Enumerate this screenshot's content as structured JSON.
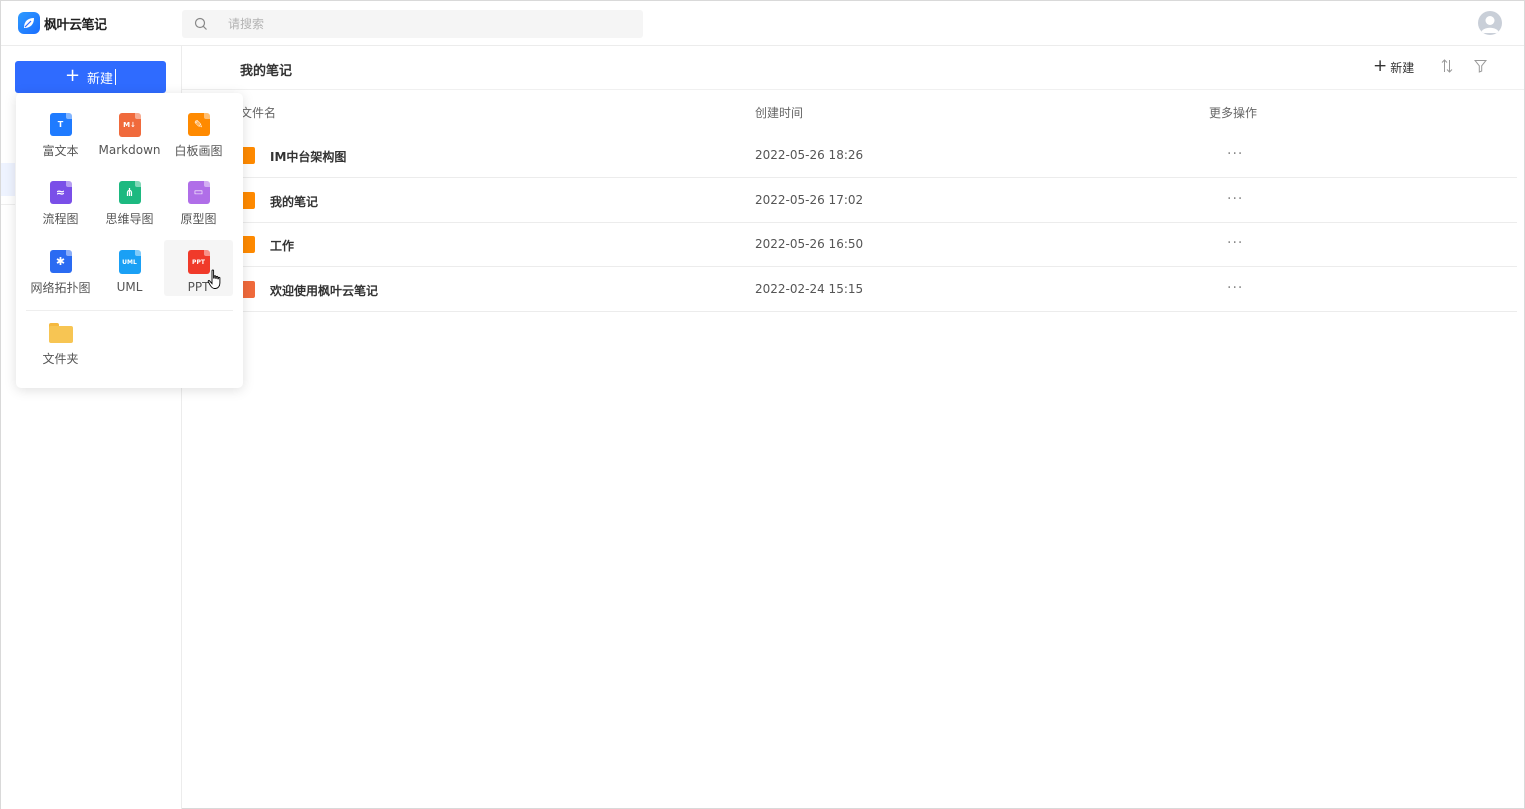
{
  "app": {
    "name": "枫叶云笔记",
    "brand_color": "#2f6bff"
  },
  "search": {
    "placeholder": "请搜索"
  },
  "sidebar": {
    "new_button_label": "新建"
  },
  "new_menu": {
    "items": [
      {
        "label": "富文本",
        "icon": "rich-text-icon",
        "color": "#1f7bff",
        "glyph": "T"
      },
      {
        "label": "Markdown",
        "icon": "markdown-icon",
        "color": "#f06a3c",
        "glyph": "M↓"
      },
      {
        "label": "白板画图",
        "icon": "whiteboard-icon",
        "color": "#ff8a00",
        "glyph": "✎"
      },
      {
        "label": "流程图",
        "icon": "flowchart-icon",
        "color": "#7a4fe8",
        "glyph": "≈"
      },
      {
        "label": "思维导图",
        "icon": "mindmap-icon",
        "color": "#1db980",
        "glyph": "⋔"
      },
      {
        "label": "原型图",
        "icon": "prototype-icon",
        "color": "#b06ee8",
        "glyph": "▭"
      },
      {
        "label": "网络拓扑图",
        "icon": "network-topology-icon",
        "color": "#2a6bf2",
        "glyph": "✱"
      },
      {
        "label": "UML",
        "icon": "uml-icon",
        "color": "#1aa0f5",
        "glyph": "UML"
      },
      {
        "label": "PPT",
        "icon": "ppt-icon",
        "color": "#f03a2a",
        "glyph": "PPT"
      }
    ],
    "folder_label": "文件夹",
    "folder_icon": "folder-icon"
  },
  "main": {
    "title": "我的笔记",
    "new_label": "新建",
    "columns": {
      "name": "文件名",
      "created": "创建时间",
      "actions": "更多操作"
    },
    "rows": [
      {
        "name": "IM中台架构图",
        "created": "2022-05-26 18:26",
        "more": "···",
        "icon": "whiteboard-icon",
        "color": "#ff8a00"
      },
      {
        "name": "我的笔记",
        "created": "2022-05-26 17:02",
        "more": "···",
        "icon": "whiteboard-icon",
        "color": "#ff8a00"
      },
      {
        "name": "工作",
        "created": "2022-05-26 16:50",
        "more": "···",
        "icon": "whiteboard-icon",
        "color": "#ff8a00"
      },
      {
        "name": "欢迎使用枫叶云笔记",
        "created": "2022-02-24 15:15",
        "more": "···",
        "icon": "markdown-icon",
        "color": "#f06a3c"
      }
    ]
  }
}
